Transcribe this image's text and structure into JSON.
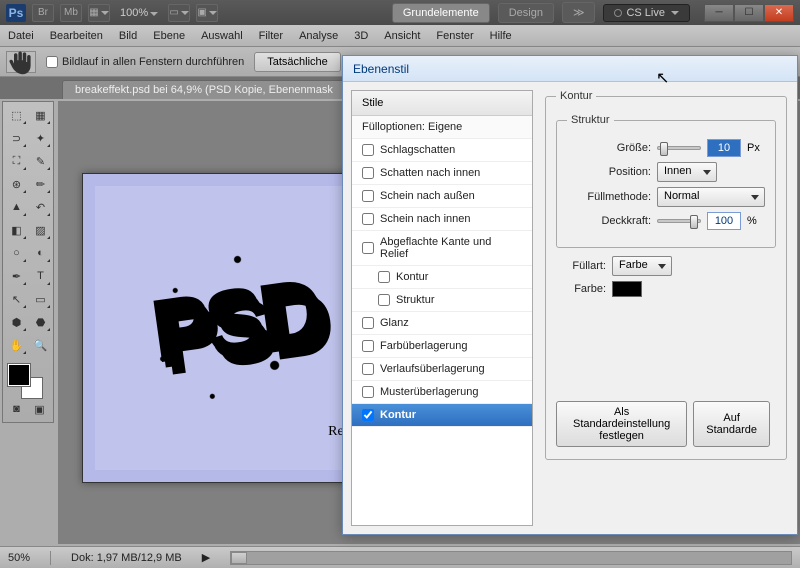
{
  "titlebar": {
    "logo": "Ps",
    "zoom": "100%",
    "tabs": {
      "grundelemente": "Grundelemente",
      "design": "Design"
    },
    "cslive": "CS Live"
  },
  "menu": [
    "Datei",
    "Bearbeiten",
    "Bild",
    "Ebene",
    "Auswahl",
    "Filter",
    "Analyse",
    "3D",
    "Ansicht",
    "Fenster",
    "Hilfe"
  ],
  "optbar": {
    "scroll_all": "Bildlauf in allen Fenstern durchführen",
    "actual": "Tatsächliche"
  },
  "doctab": "breakeffekt.psd bei 64,9% (PSD Kopie, Ebenenmask",
  "canvas": {
    "text": "PSD",
    "relaunch": "Relaunch"
  },
  "status": {
    "zoom": "50%",
    "doc": "Dok: 1,97 MB/12,9 MB"
  },
  "dialog": {
    "title": "Ebenenstil",
    "stile": "Stile",
    "fill": "Fülloptionen: Eigene",
    "items": {
      "schlagschatten": "Schlagschatten",
      "schatten_innen": "Schatten nach innen",
      "schein_aussen": "Schein nach außen",
      "schein_innen": "Schein nach innen",
      "kante": "Abgeflachte Kante und Relief",
      "kontur_sub": "Kontur",
      "struktur_sub": "Struktur",
      "glanz": "Glanz",
      "farbueb": "Farbüberlagerung",
      "verlauf": "Verlaufsüberlagerung",
      "muster": "Musterüberlagerung",
      "kontur": "Kontur"
    },
    "right": {
      "kontur_legend": "Kontur",
      "struktur_legend": "Struktur",
      "groesse_lbl": "Größe:",
      "groesse_val": "10",
      "groesse_unit": "Px",
      "position_lbl": "Position:",
      "position_val": "Innen",
      "fuellmethode_lbl": "Füllmethode:",
      "fuellmethode_val": "Normal",
      "deckkraft_lbl": "Deckkraft:",
      "deckkraft_val": "100",
      "deckkraft_unit": "%",
      "fuellart_lbl": "Füllart:",
      "fuellart_val": "Farbe",
      "farbe_lbl": "Farbe:",
      "standard_btn": "Als Standardeinstellung festlegen",
      "reset_btn": "Auf Standarde"
    }
  }
}
